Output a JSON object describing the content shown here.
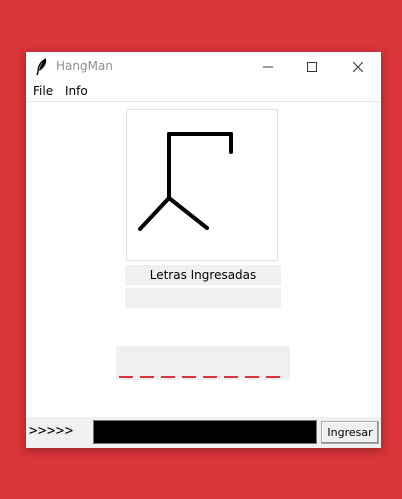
{
  "window": {
    "title": "HangMan",
    "icon": "feather-icon",
    "controls": [
      "minimize-icon",
      "maximize-icon",
      "close-icon"
    ]
  },
  "menu": {
    "file": "File",
    "info": "Info"
  },
  "game": {
    "letters_label": "Letras Ingresadas",
    "letters_value": "",
    "hidden_word_length": 8,
    "dash_color": "#d9353a"
  },
  "input": {
    "prompt": ">>>>>",
    "value": "",
    "submit_label": "Ingresar"
  }
}
